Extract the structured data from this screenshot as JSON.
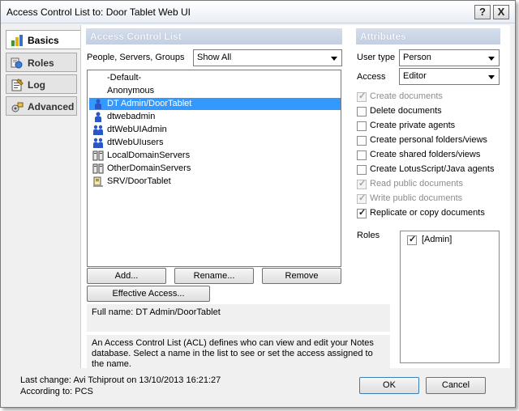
{
  "window": {
    "title": "Access Control List to: Door Tablet Web UI",
    "help_label": "?",
    "close_label": "X"
  },
  "nav": {
    "items": [
      {
        "label": "Basics",
        "icon": "basics-icon",
        "active": true
      },
      {
        "label": "Roles",
        "icon": "roles-icon",
        "active": false
      },
      {
        "label": "Log",
        "icon": "log-icon",
        "active": false
      },
      {
        "label": "Advanced",
        "icon": "advanced-icon",
        "active": false
      }
    ]
  },
  "acl": {
    "header": "Access Control List",
    "filter_label": "People, Servers, Groups",
    "filter_value": "Show All",
    "entries": [
      {
        "name": "-Default-",
        "icon": "none",
        "selected": false
      },
      {
        "name": "Anonymous",
        "icon": "none",
        "selected": false
      },
      {
        "name": "DT Admin/DoorTablet",
        "icon": "person-icon",
        "selected": true
      },
      {
        "name": "dtwebadmin",
        "icon": "person-icon",
        "selected": false
      },
      {
        "name": "dtWebUIAdmin",
        "icon": "group-icon",
        "selected": false
      },
      {
        "name": "dtWebUIusers",
        "icon": "group-icon",
        "selected": false
      },
      {
        "name": "LocalDomainServers",
        "icon": "server-group-icon",
        "selected": false
      },
      {
        "name": "OtherDomainServers",
        "icon": "server-group-icon",
        "selected": false
      },
      {
        "name": "SRV/DoorTablet",
        "icon": "server-icon",
        "selected": false
      }
    ],
    "buttons": {
      "add": "Add...",
      "rename": "Rename...",
      "remove": "Remove",
      "effective_access": "Effective Access..."
    },
    "full_name": "Full name: DT Admin/DoorTablet",
    "description": "An Access Control List (ACL) defines who can view and edit your Notes database.  Select a name in the list to see or set the access assigned to the name."
  },
  "attributes": {
    "header": "Attributes",
    "user_type_label": "User type",
    "user_type_value": "Person",
    "access_label": "Access",
    "access_value": "Editor",
    "options": [
      {
        "label": "Create documents",
        "checked": true,
        "disabled": true
      },
      {
        "label": "Delete documents",
        "checked": false,
        "disabled": false
      },
      {
        "label": "Create private agents",
        "checked": false,
        "disabled": false
      },
      {
        "label": "Create personal folders/views",
        "checked": false,
        "disabled": false
      },
      {
        "label": "Create shared folders/views",
        "checked": false,
        "disabled": false
      },
      {
        "label": "Create LotusScript/Java agents",
        "checked": false,
        "disabled": false
      },
      {
        "label": "Read public documents",
        "checked": true,
        "disabled": true
      },
      {
        "label": "Write public documents",
        "checked": true,
        "disabled": true
      },
      {
        "label": "Replicate or copy documents",
        "checked": true,
        "disabled": false
      }
    ],
    "roles_label": "Roles",
    "roles": [
      {
        "label": "[Admin]",
        "checked": true
      }
    ]
  },
  "footer": {
    "last_change": "Last change: Avi Tchiprout on 13/10/2013 16:21:27",
    "according_to": "According to: PCS",
    "ok": "OK",
    "cancel": "Cancel"
  },
  "colors": {
    "selection": "#3399ff",
    "section_header": "#c3cfe2",
    "dialog_bg": "#f0f0f0"
  }
}
